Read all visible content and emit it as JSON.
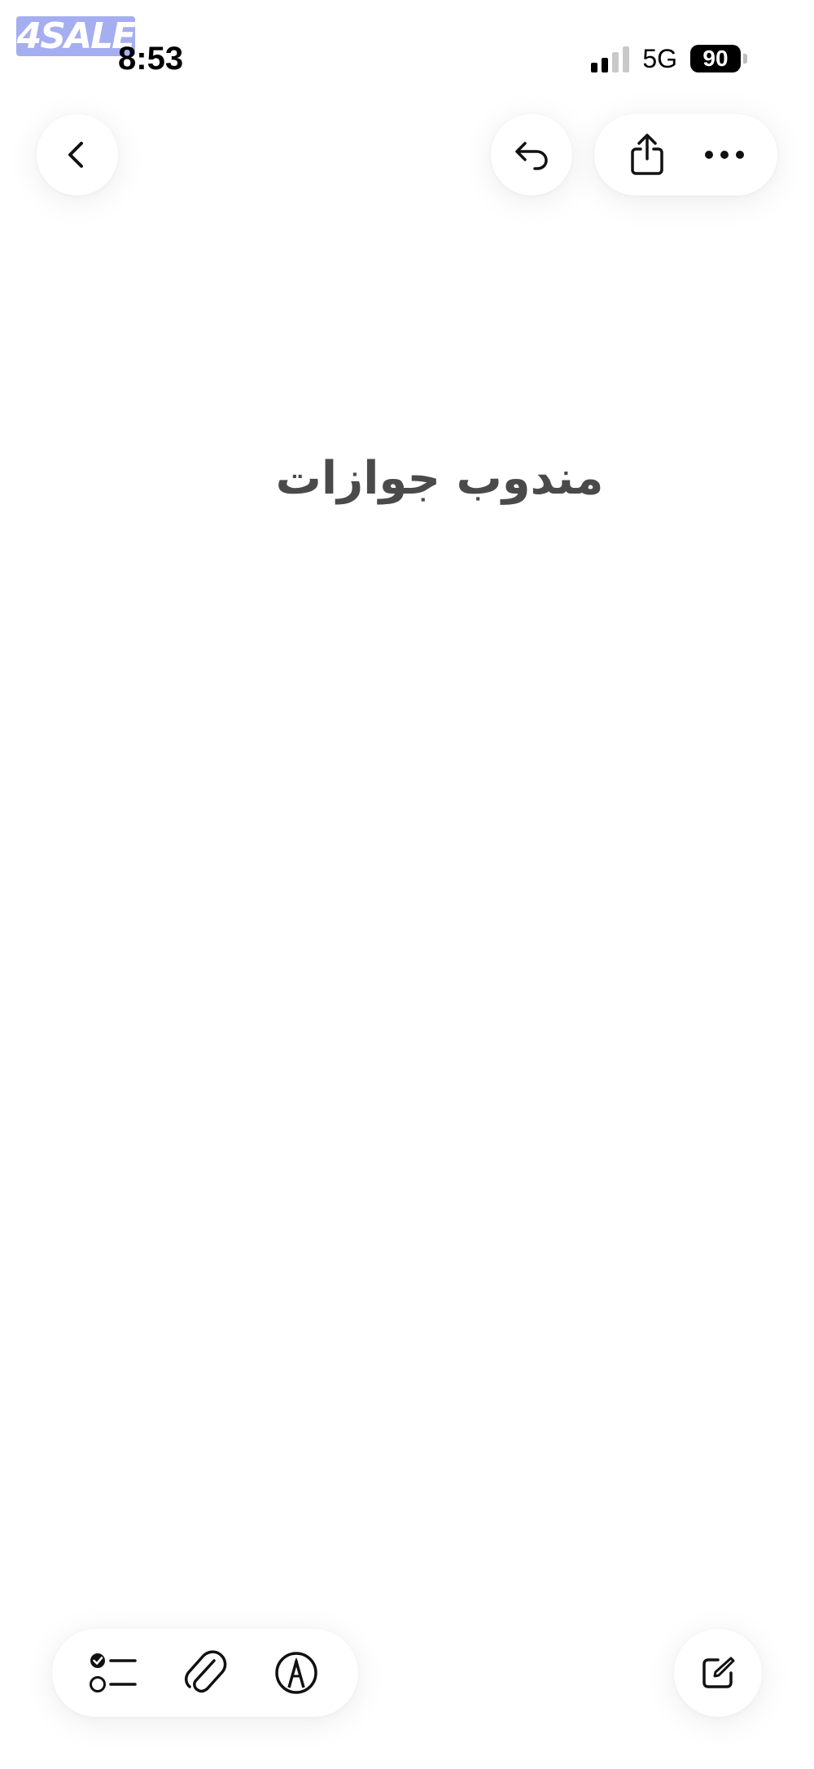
{
  "watermark": {
    "text": "4SALE"
  },
  "status_bar": {
    "time": "8:53",
    "network": "5G",
    "battery": "90"
  },
  "top_bar": {
    "back_icon": "chevron-left-icon",
    "undo_icon": "undo-icon",
    "share_icon": "share-icon",
    "more_icon": "ellipsis-icon"
  },
  "note": {
    "title": "مندوب جوازات"
  },
  "bottom_toolbar": {
    "checklist_icon": "checklist-icon",
    "attachment_icon": "paperclip-icon",
    "markup_icon": "pen-markup-icon",
    "compose_icon": "compose-icon"
  }
}
